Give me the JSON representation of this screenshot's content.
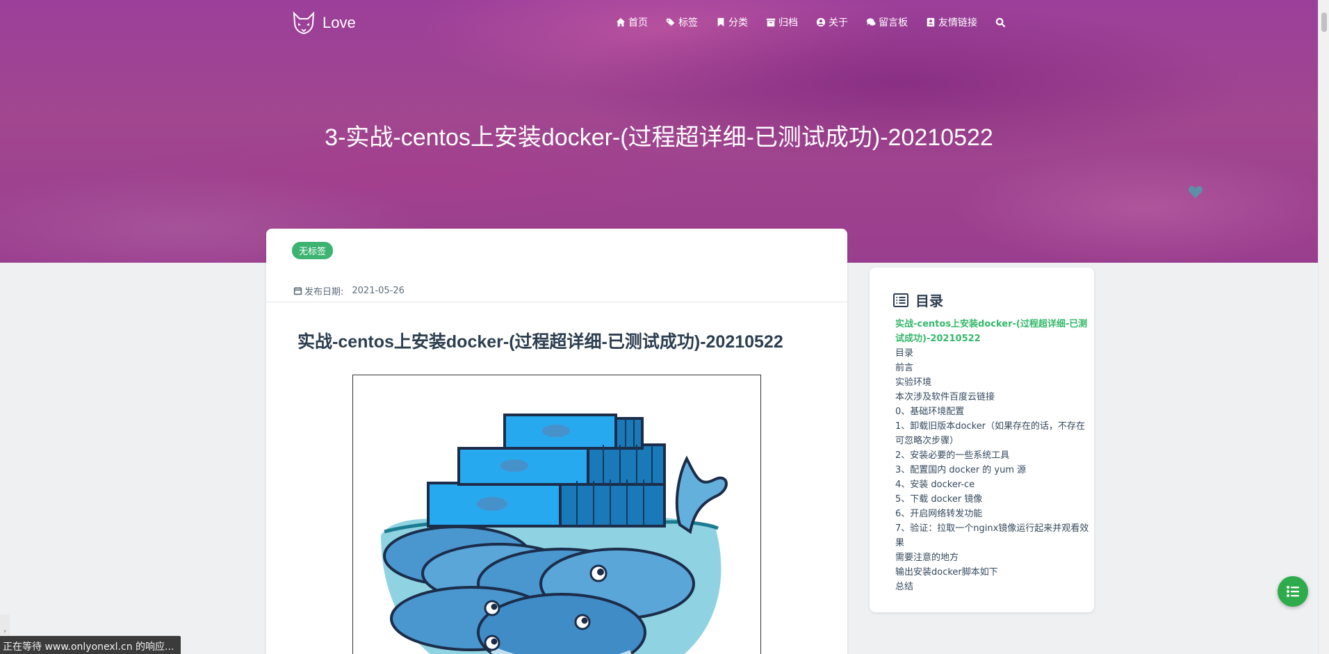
{
  "navbar": {
    "brand": "Love",
    "items": [
      {
        "label": "首页",
        "icon": "home-icon"
      },
      {
        "label": "标签",
        "icon": "tags-icon"
      },
      {
        "label": "分类",
        "icon": "bookmark-icon"
      },
      {
        "label": "归档",
        "icon": "archive-icon"
      },
      {
        "label": "关于",
        "icon": "user-circle-icon"
      },
      {
        "label": "留言板",
        "icon": "comments-icon"
      },
      {
        "label": "友情链接",
        "icon": "address-card-icon"
      }
    ],
    "search_icon": "search-icon"
  },
  "hero": {
    "title": "3-实战-centos上安装docker-(过程超详细-已测试成功)-20210522"
  },
  "article": {
    "tag": "无标签",
    "date_label": "发布日期:",
    "date_value": "2021-05-26",
    "heading": "实战-centos上安装docker-(过程超详细-已测试成功)-20210522"
  },
  "toc": {
    "title": "目录",
    "items": [
      "实战-centos上安装docker-(过程超详细-已测试成功)-20210522",
      "目录",
      "前言",
      "实验环境",
      "本次涉及软件百度云链接",
      "0、基础环境配置",
      "1、卸载旧版本docker（如果存在的话，不存在可忽略次步骤）",
      "2、安装必要的一些系统工具",
      "3、配置国内 docker 的 yum 源",
      "4、安装 docker-ce",
      "5、下载 docker 镜像",
      "6、开启网络转发功能",
      "7、验证：拉取一个nginx镜像运行起来并观看效果",
      "需要注意的地方",
      "输出安装docker脚本如下",
      "总结"
    ]
  },
  "status_bar": {
    "text": "正在等待 www.onlyonexl.cn 的响应..."
  },
  "colors": {
    "accent_green": "#35b86a",
    "hero_purple": "#9b3f9a",
    "fab_green": "#2eab4b"
  }
}
